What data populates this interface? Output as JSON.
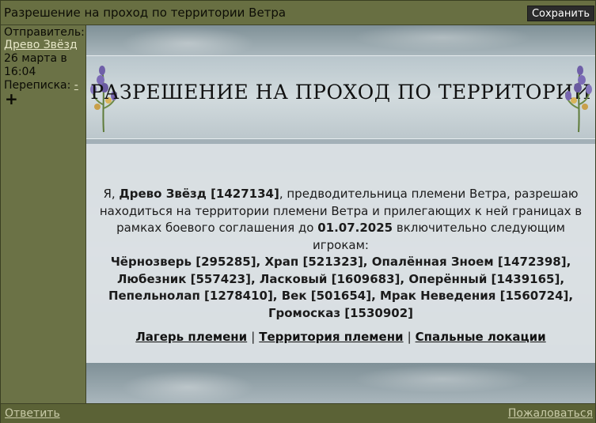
{
  "window": {
    "title": "Разрешение на проход по территории Ветра",
    "save_label": "Сохранить"
  },
  "sidebar": {
    "sender_label": "Отправитель:",
    "sender_name": "Древо Звёзд",
    "date_line1": "26 марта в",
    "date_line2": "16:04",
    "thread_label": "Переписка:",
    "thread_link": "-",
    "plus": "+"
  },
  "post": {
    "banner_title": "РАЗРЕШЕНИЕ НА ПРОХОД ПО ТЕРРИТОРИИ",
    "intro_1": "Я, ",
    "author": "Древо Звёзд [1427134]",
    "intro_2": ", предводительница племени Ветра, разрешаю находиться на территории племени Ветра и прилегающих к ней границах в рамках боевого соглашения до ",
    "date": "01.07.2025",
    "intro_3": " включительно следующим игрокам:",
    "players": "Чёрнозверь [295285], Храп [521323], Опалённая Зноем [1472398], Любезник [557423], Ласковый [1609683], Оперённый [1439165], Пепельнолап [1278410], Век [501654], Мрак Неведения [1560724], Громосказ [1530902]",
    "links": [
      "Лагерь племени",
      "Территория племени",
      "Спальные локации"
    ],
    "separator": "|"
  },
  "footer": {
    "reply": "Ответить",
    "report": "Пожаловаться"
  },
  "colors": {
    "page_bg": "#5b6236",
    "sidebar_bg": "#6b7246",
    "button_bg": "#2b2b2b"
  }
}
